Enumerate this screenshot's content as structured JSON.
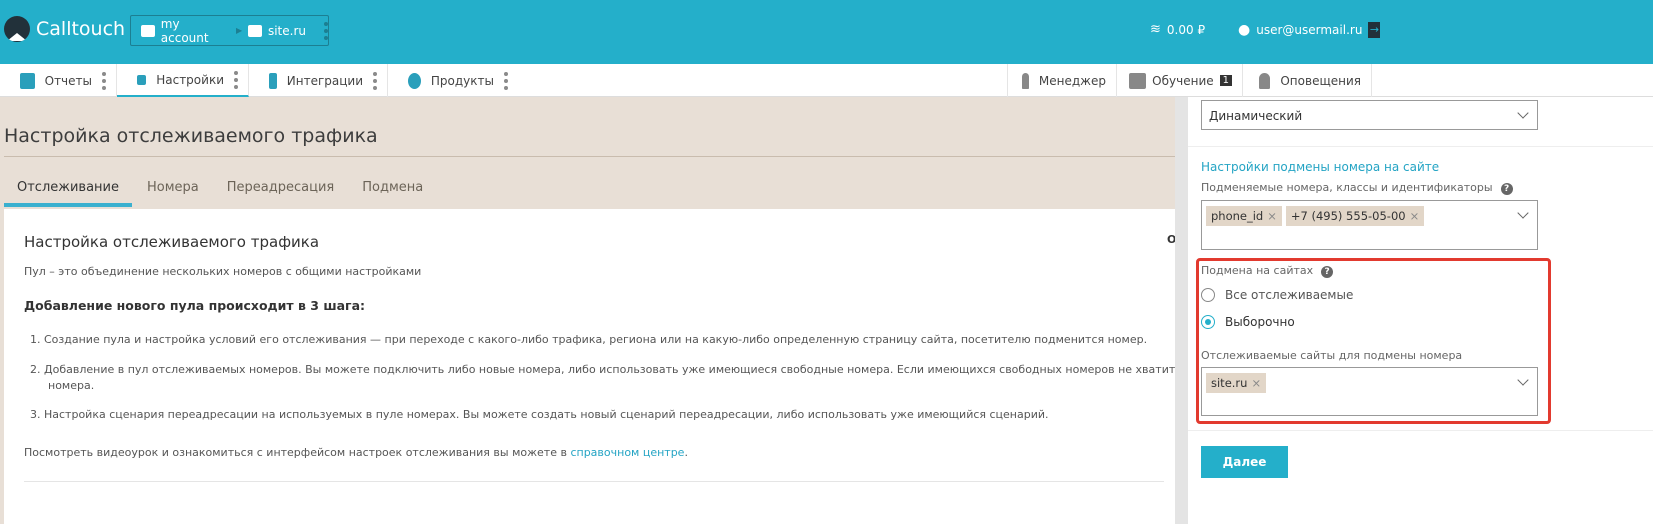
{
  "header": {
    "brand": "Calltouch",
    "account": "my account",
    "site": "site.ru",
    "balance": "0.00 ₽",
    "user": "user@usermail.ru"
  },
  "nav": {
    "items": [
      {
        "label": "Отчеты"
      },
      {
        "label": "Настройки"
      },
      {
        "label": "Интеграции"
      },
      {
        "label": "Продукты"
      }
    ],
    "right": [
      {
        "label": "Менеджер"
      },
      {
        "label": "Обучение",
        "badge": "1"
      },
      {
        "label": "Оповещения"
      }
    ]
  },
  "page": {
    "title": "Настройка отслеживаемого трафика",
    "tabs": [
      "Отслеживание",
      "Номера",
      "Переадресация",
      "Подмена"
    ]
  },
  "card": {
    "heading": "Настройка отслеживаемого трафика",
    "pool": "Пул – это объединение нескольких номеров с общими настройками",
    "steps_title": "Добавление нового пула происходит в 3 шага:",
    "steps": [
      "1.   Создание пула и настройка условий его отслеживания — при переходе с какого-либо трафика, региона или на какую-либо определенную страницу сайта, посетителю подменится номер.",
      "2.   Добавление в пул отслеживаемых номеров. Вы можете подключить либо новые номера, либо использовать уже имеющиеся свободные номера. Если имеющихся свободных номеров не хватит, можно",
      "3.   Настройка сценария переадресации на используемых в пуле номерах. Вы можете создать новый сценарий переадресации, либо использовать уже имеющийся сценарий."
    ],
    "step2_cont": "номера.",
    "footer_text": "Посмотреть видеоурок и ознакомиться с интерфейсом настроек отслеживания вы можете в ",
    "footer_link": "справочном центре",
    "footer_end": ".",
    "cut": "Общ"
  },
  "panel": {
    "type_value": "Динамический",
    "section_title": "Настройки подмены номера на сайте",
    "replaced_label": "Подменяемые номера, классы и идентификаторы",
    "replaced_tags": [
      "phone_id",
      "+7 (495) 555-05-00"
    ],
    "sites_label": "Подмена на сайтах",
    "radio_all": "Все отслеживаемые",
    "radio_selected": "Выборочно",
    "selected_option": "Выборочно",
    "tracked_label": "Отслеживаемые сайты для подмены номера",
    "tracked_tags": [
      "site.ru"
    ],
    "next": "Далее",
    "accent": "#24afca",
    "highlight": "#e23a2f"
  }
}
